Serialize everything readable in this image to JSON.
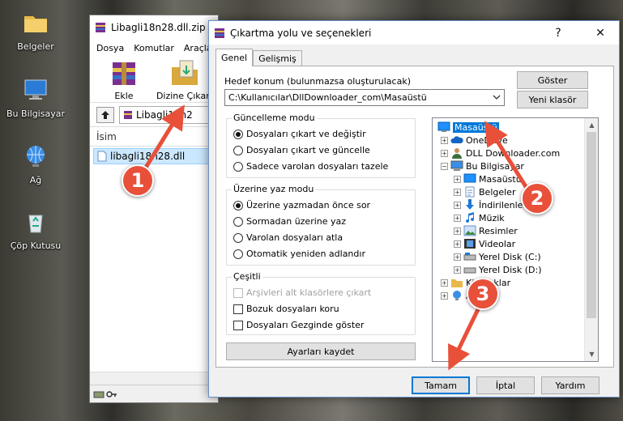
{
  "desktop": {
    "icons": [
      {
        "label": "Belgeler",
        "icon": "folder-icon"
      },
      {
        "label": "Bu Bilgisayar",
        "icon": "computer-icon"
      },
      {
        "label": "Ağ",
        "icon": "network-icon"
      },
      {
        "label": "Çöp Kutusu",
        "icon": "recycle-bin-icon"
      }
    ]
  },
  "winrar": {
    "title": "Libagli18n28.dll.zip",
    "menu": [
      "Dosya",
      "Komutlar",
      "Araçla"
    ],
    "tools": [
      {
        "label": "Ekle",
        "icon": "add-archive-icon"
      },
      {
        "label": "Dizine Çıkart",
        "icon": "extract-to-icon"
      }
    ],
    "path": "Libagli18n2",
    "column_name": "İsim",
    "file": "libagli18n28.dll"
  },
  "dialog": {
    "title": "Çıkartma yolu ve seçenekleri",
    "tabs": [
      "Genel",
      "Gelişmiş"
    ],
    "dest_label": "Hedef konum (bulunmazsa oluşturulacak)",
    "dest_value": "C:\\Kullanıcılar\\DllDownloader_com\\Masaüstü",
    "btn_show": "Göster",
    "btn_new_folder": "Yeni klasör",
    "update_mode": {
      "title": "Güncelleme modu",
      "options": [
        {
          "label": "Dosyaları çıkart ve değiştir",
          "selected": true
        },
        {
          "label": "Dosyaları çıkart ve güncelle",
          "selected": false
        },
        {
          "label": "Sadece varolan dosyaları tazele",
          "selected": false
        }
      ]
    },
    "overwrite_mode": {
      "title": "Üzerine yaz modu",
      "options": [
        {
          "label": "Üzerine yazmadan önce sor",
          "selected": true
        },
        {
          "label": "Sormadan üzerine yaz",
          "selected": false
        },
        {
          "label": "Varolan dosyaları atla",
          "selected": false
        },
        {
          "label": "Otomatik yeniden adlandır",
          "selected": false
        }
      ]
    },
    "misc": {
      "title": "Çeşitli",
      "options": [
        {
          "label": "Arşivleri alt klasörlere çıkart",
          "checked": false,
          "disabled": true
        },
        {
          "label": "Bozuk dosyaları koru",
          "checked": false,
          "disabled": false
        },
        {
          "label": "Dosyaları Gezginde göster",
          "checked": false,
          "disabled": false
        }
      ]
    },
    "btn_save_settings": "Ayarları kaydet",
    "tree": [
      {
        "label": "Masaüstü",
        "icon": "desktop-icon",
        "selected": true
      },
      {
        "label": "OneDrive",
        "icon": "onedrive-icon"
      },
      {
        "label": "DLL Downloader.com",
        "icon": "user-icon"
      },
      {
        "label": "Bu Bilgisayar",
        "icon": "computer-icon"
      },
      {
        "label": "Masaüstü",
        "icon": "desktop-icon"
      },
      {
        "label": "Belgeler",
        "icon": "documents-icon"
      },
      {
        "label": "İndirilenler",
        "icon": "downloads-icon"
      },
      {
        "label": "Müzik",
        "icon": "music-icon"
      },
      {
        "label": "Resimler",
        "icon": "pictures-icon"
      },
      {
        "label": "Videolar",
        "icon": "videos-icon"
      },
      {
        "label": "Yerel Disk (C:)",
        "icon": "disk-icon"
      },
      {
        "label": "Yerel Disk (D:)",
        "icon": "disk-icon"
      },
      {
        "label": "Kitaplıklar",
        "icon": "libraries-icon"
      },
      {
        "label": "Ağ",
        "icon": "network-icon"
      }
    ],
    "btn_ok": "Tamam",
    "btn_cancel": "İptal",
    "btn_help": "Yardım",
    "help_glyph": "?",
    "close_glyph": "✕"
  },
  "annotations": [
    "1",
    "2",
    "3"
  ],
  "colors": {
    "annotation": "#e8503a",
    "selection": "#0078d7",
    "arrow": "#e8503a"
  }
}
